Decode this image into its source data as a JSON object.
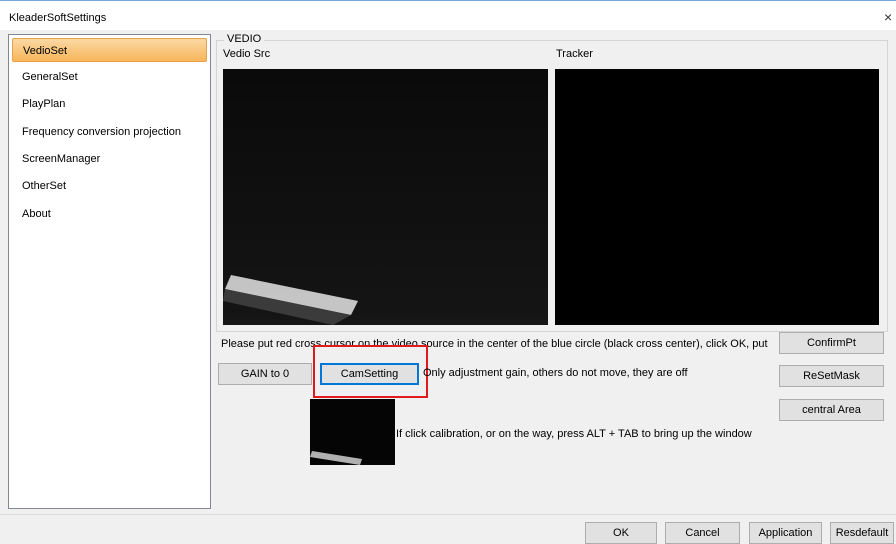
{
  "window": {
    "title": "KleaderSoftSettings",
    "close_glyph": "×"
  },
  "sidebar": {
    "items": [
      {
        "label": "VedioSet",
        "selected": true
      },
      {
        "label": "GeneralSet"
      },
      {
        "label": "PlayPlan"
      },
      {
        "label": "Frequency conversion projection"
      },
      {
        "label": "ScreenManager"
      },
      {
        "label": "OtherSet"
      },
      {
        "label": "About"
      }
    ]
  },
  "vedio": {
    "group_label": "VEDIO",
    "source_label": "Vedio Src",
    "tracker_label": "Tracker",
    "instruction": "Please put red cross cursor on the video source in the center of the blue circle (black cross center), click OK, put",
    "gain_note": "Only adjustment gain, others do not move, they are off",
    "calibration_note": "If click calibration, or on the way, press ALT + TAB to bring up the window",
    "buttons": {
      "confirm": "ConfirmPt",
      "gain_zero": "GAIN to 0",
      "cam_setting": "CamSetting",
      "reset_mask": "ReSetMask",
      "central_area": "central Area"
    }
  },
  "footer": {
    "ok": "OK",
    "cancel": "Cancel",
    "application": "Application",
    "resdefault": "Resdefault"
  },
  "colors": {
    "selection": "#f7b65a",
    "highlight_box": "#e01b1b",
    "video_bg": "#000000"
  }
}
